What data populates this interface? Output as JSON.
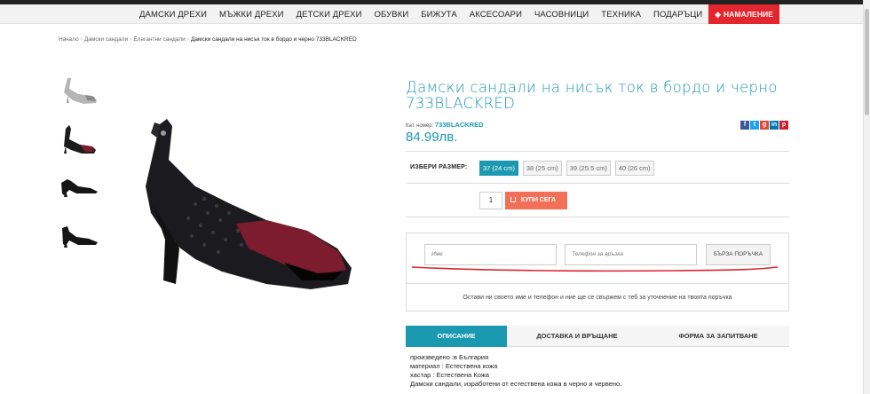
{
  "nav": {
    "items": [
      "ДАМСКИ ДРЕХИ",
      "МЪЖКИ ДРЕХИ",
      "ДЕТСКИ ДРЕХИ",
      "ОБУВКИ",
      "БИЖУТА",
      "АКСЕСОАРИ",
      "ЧАСОВНИЦИ",
      "ТЕХНИКА",
      "ПОДАРЪЦИ"
    ],
    "sale_label": "НАМАЛЕНИЕ"
  },
  "breadcrumb": {
    "home": "Начало",
    "cat1": "Дамски сандали",
    "cat2": "Елегантни сандали",
    "current": "Дамски сандали на нисък ток в бордо и черно 733BLACKRED",
    "separator": "›"
  },
  "product": {
    "title": "Дамски сандали на нисък ток в бордо и черно 733BLACKRED",
    "sku_label": "Кат. номер:",
    "sku": "733BLACKRED",
    "price": "84.99лв.",
    "size_label": "ИЗБЕРИ РАЗМЕР:",
    "sizes": [
      "37 (24 cm)",
      "38 (25 cm)",
      "39 (25.5 cm)",
      "40 (26 cm)"
    ],
    "selected_size": "37 (24 cm)",
    "quantity": "1",
    "buy_label": "КУПИ СЕГА"
  },
  "quick_order": {
    "name_placeholder": "Име",
    "phone_placeholder": "Телефон за връзка",
    "button_label": "БЪРЗА ПОРЪЧКА",
    "note": "Остави ни своето име и телефон и ние ще се свържем с теб за уточнение на твоята поръчка"
  },
  "tabs": [
    "ОПИСАНИЕ",
    "ДОСТАВКА И ВРЪЩАНЕ",
    "ФОРМА ЗА ЗАПИТВАНЕ"
  ],
  "description": [
    "произведено :в България",
    "материал : Естествена кожа",
    "хастар : Естествена Кожа",
    "Дамски сандали, изработени от естествена кожа в черно и червено."
  ],
  "share_icons": [
    "facebook-icon",
    "twitter-icon",
    "google-plus-icon",
    "linkedin-icon",
    "pinterest-icon"
  ],
  "colors": {
    "accent": "#1a99b0",
    "buy": "#f37058",
    "sale": "#e3262e",
    "annotation": "#d9262e"
  }
}
